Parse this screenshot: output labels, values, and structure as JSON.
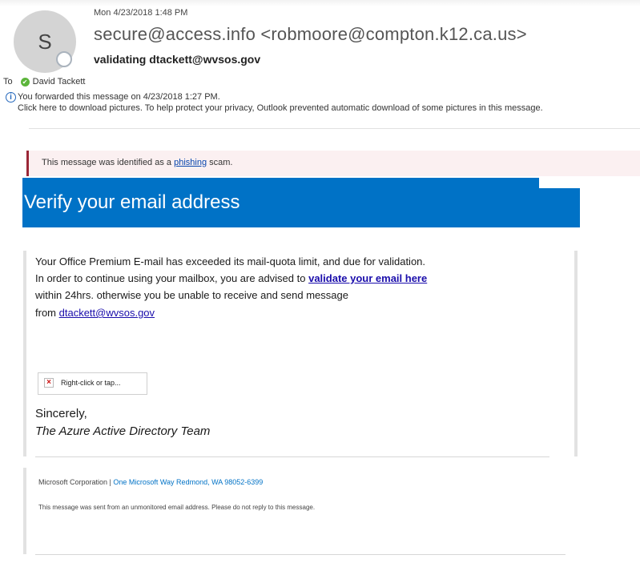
{
  "message": {
    "avatar_initial": "S",
    "date": "Mon 4/23/2018 1:48 PM",
    "from": "secure@access.info <robmoore@compton.k12.ca.us>",
    "subject": "validating  dtackett@wvsos.gov",
    "to_label": "To",
    "recipient": "David Tackett",
    "forward_note": "You forwarded this message on 4/23/2018 1:27 PM.",
    "pictures_note": "Click here to download pictures. To help protect your privacy, Outlook prevented automatic download of some pictures in this message."
  },
  "phishing_banner": {
    "prefix": "This message was identified as a ",
    "link": "phishing",
    "suffix": " scam.",
    "accent_color": "#9a2737"
  },
  "email_body": {
    "title": "Verify your email address",
    "line1": "Your Office Premium E-mail has exceeded its mail-quota limit, and due for validation.",
    "line2_prefix": "In order  to continue using your mailbox, you are advised to  ",
    "line2_link": "validate your email here",
    "line3": "within 24hrs. otherwise you be unable to receive and send message",
    "line4_prefix": "from  ",
    "line4_link": "dtackett@wvsos.gov",
    "broken_image_text": "Right-click or tap...",
    "sincerely": "Sincerely,",
    "team": "The Azure Active Directory Team",
    "brand_color": "#0072c6"
  },
  "footer": {
    "company": "Microsoft Corporation | ",
    "address": "One Microsoft Way Redmond, WA 98052-6399",
    "note": "This message was sent from an unmonitored email address. Please do not reply to this message."
  }
}
